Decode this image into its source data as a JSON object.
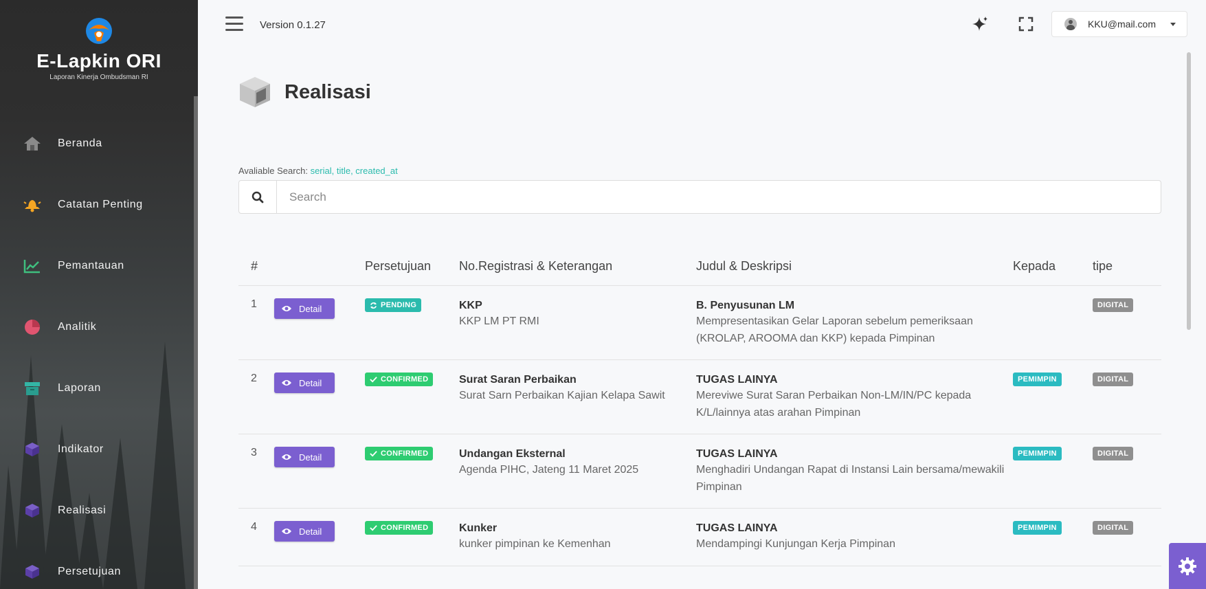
{
  "brand": {
    "title": "E-Lapkin ORI",
    "subtitle": "Laporan Kinerja Ombudsman RI"
  },
  "sidebar": {
    "items": [
      {
        "label": "Beranda",
        "icon": "home-icon"
      },
      {
        "label": "Catatan Penting",
        "icon": "bell-icon"
      },
      {
        "label": "Pemantauan",
        "icon": "line-chart-icon"
      },
      {
        "label": "Analitik",
        "icon": "pie-chart-icon"
      },
      {
        "label": "Laporan",
        "icon": "archive-icon"
      },
      {
        "label": "Indikator",
        "icon": "cube-icon"
      },
      {
        "label": "Realisasi",
        "icon": "cube-icon"
      },
      {
        "label": "Persetujuan",
        "icon": "cube-icon"
      }
    ]
  },
  "topbar": {
    "version": "Version 0.1.27",
    "user_email": "KKU@mail.com"
  },
  "page": {
    "title": "Realisasi"
  },
  "search": {
    "available_label": "Avaliable Search:",
    "available_keys": "serial, title, created_at",
    "placeholder": "Search"
  },
  "table": {
    "headers": {
      "num": "#",
      "approval": "Persetujuan",
      "registration": "No.Registrasi & Keterangan",
      "title": "Judul & Deskripsi",
      "to": "Kepada",
      "type": "tipe"
    },
    "detail_label": "Detail",
    "rows": [
      {
        "num": "1",
        "status": "PENDING",
        "reg_title": "KKP",
        "reg_desc": "KKP LM PT RMI",
        "judul": "B. Penyusunan LM",
        "desc": "Mempresentasikan Gelar Laporan sebelum pemeriksaan (KROLAP, AROOMA dan KKP) kepada Pimpinan",
        "kepada": "",
        "tipe": "DIGITAL"
      },
      {
        "num": "2",
        "status": "CONFIRMED",
        "reg_title": "Surat Saran Perbaikan",
        "reg_desc": "Surat Sarn Perbaikan Kajian Kelapa Sawit",
        "judul": "TUGAS LAINYA",
        "desc": "Mereviwe Surat Saran Perbaikan Non-LM/IN/PC kepada K/L/lainnya atas arahan Pimpinan",
        "kepada": "PEMIMPIN",
        "tipe": "DIGITAL"
      },
      {
        "num": "3",
        "status": "CONFIRMED",
        "reg_title": "Undangan Eksternal",
        "reg_desc": "Agenda PIHC, Jateng 11 Maret 2025",
        "judul": "TUGAS LAINYA",
        "desc": "Menghadiri Undangan Rapat di Instansi Lain bersama/mewakili Pimpinan",
        "kepada": "PEMIMPIN",
        "tipe": "DIGITAL"
      },
      {
        "num": "4",
        "status": "CONFIRMED",
        "reg_title": "Kunker",
        "reg_desc": "kunker pimpinan ke Kemenhan",
        "judul": "TUGAS LAINYA",
        "desc": "Mendampingi Kunjungan Kerja Pimpinan",
        "kepada": "PEMIMPIN",
        "tipe": "DIGITAL"
      }
    ]
  },
  "colors": {
    "accent": "#7b5fd0",
    "teal": "#2bbbad",
    "green": "#2ecc71",
    "gray_badge": "#8f8f8f"
  }
}
